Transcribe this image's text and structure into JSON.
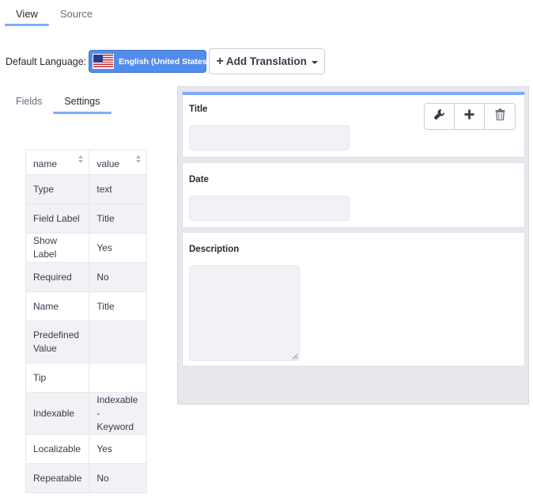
{
  "top_tabs": [
    {
      "label": "View",
      "active": true
    },
    {
      "label": "Source",
      "active": false
    }
  ],
  "language": {
    "label": "Default Language:",
    "selected": "English (United States)",
    "flag_icon": "us-flag-icon",
    "add_translation_label": "Add Translation"
  },
  "side_tabs": [
    {
      "label": "Fields",
      "active": false
    },
    {
      "label": "Settings",
      "active": true
    }
  ],
  "properties_table": {
    "headers": [
      "name",
      "value"
    ],
    "rows": [
      {
        "name": "Type",
        "value": "text"
      },
      {
        "name": "Field Label",
        "value": "Title"
      },
      {
        "name": "Show Label",
        "value": "Yes"
      },
      {
        "name": "Required",
        "value": "No"
      },
      {
        "name": "Name",
        "value": "Title"
      },
      {
        "name": "Predefined Value",
        "value": ""
      },
      {
        "name": "Tip",
        "value": ""
      },
      {
        "name": "Indexable",
        "value": "Indexable - Keyword"
      },
      {
        "name": "Localizable",
        "value": "Yes"
      },
      {
        "name": "Repeatable",
        "value": "No"
      }
    ]
  },
  "form_fields": [
    {
      "label": "Title",
      "type": "text",
      "selected": true
    },
    {
      "label": "Date",
      "type": "text",
      "selected": false
    },
    {
      "label": "Description",
      "type": "textarea",
      "selected": false
    }
  ],
  "field_actions": [
    "wrench-icon",
    "plus-icon",
    "trash-icon"
  ],
  "colors": {
    "accent": "#80acff",
    "language_button": "#528dec",
    "canvas_background": "#e7e7ed",
    "input_background": "#f1f2f5"
  }
}
